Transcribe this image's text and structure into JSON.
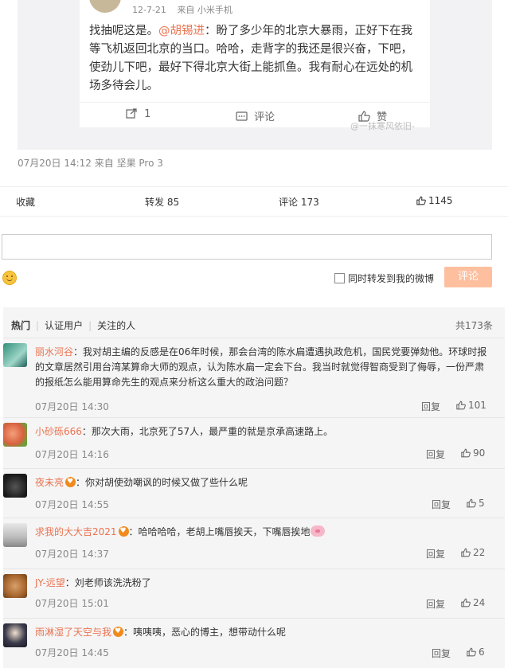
{
  "repost": {
    "date": "12-7-21",
    "source": "来自 小米手机",
    "text_prefix": "找抽呢这是。",
    "mention": "@胡锡进",
    "text_body": "：盼了多少年的北京大暴雨，正好下在我等飞机返回北京的当口。哈哈，走背字的我还是很兴奋，下吧，使劲儿下吧，最好下得北京大街上能抓鱼。我有耐心在远处的机场多待会儿。",
    "actions": {
      "share_count": "1",
      "comment_label": "评论",
      "like_label": "赞"
    },
    "watermark": "@一抹寒风依旧-"
  },
  "post": {
    "meta": "07月20日 14:12 来自 坚果 Pro 3",
    "actions": {
      "favorite": "收藏",
      "repost": "转发 85",
      "comment": "评论 173",
      "likes": "1145"
    }
  },
  "composer": {
    "also_repost_label": "同时转发到我的微博",
    "submit_label": "评论"
  },
  "comments": {
    "tabs": [
      "热门",
      "认证用户",
      "关注的人"
    ],
    "total": "共173条",
    "reply_label": "回复",
    "items": [
      {
        "user": "丽水河谷",
        "text": "：我对胡主编的反感是在06年时候，那会台湾的陈水扁遭遇执政危机，国民党要弹劾他。环球时报的文章居然引用台湾某算命大师的观点，认为陈水扁一定会下台。我当时就觉得智商受到了侮辱，一份严肃的报纸怎么能用算命先生的观点来分析这么重大的政治问题？",
        "time": "07月20日 14:30",
        "likes": "101"
      },
      {
        "user": "小砂砾666",
        "text": "：那次大雨，北京死了57人，最严重的就是京承高速路上。",
        "time": "07月20日 14:16",
        "likes": "90"
      },
      {
        "user": "夜未亮",
        "text": "：你对胡使劲嘲讽的时候又做了些什么呢",
        "time": "07月20日 14:55",
        "likes": "5"
      },
      {
        "user": "求我的大大吉2021",
        "text": "：哈哈哈哈，老胡上嘴唇挨天，下嘴唇挨地",
        "time": "07月20日 14:37",
        "likes": "22"
      },
      {
        "user": "JY-远望",
        "text": "：刘老师该洗洗粉了",
        "time": "07月20日 15:01",
        "likes": "24"
      },
      {
        "user": "雨淋湿了天空与我",
        "text": "：咦咦咦，恶心的博主，想带动什么呢",
        "time": "07月20日 14:45",
        "likes": "6"
      }
    ]
  }
}
